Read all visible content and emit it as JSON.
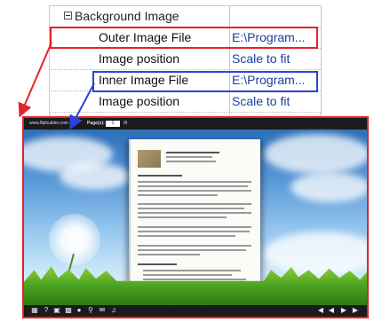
{
  "property_grid": {
    "category": {
      "label": "Background Image"
    },
    "rows": [
      {
        "name": "Outer Image File",
        "value": "E:\\Program..."
      },
      {
        "name": "Image position",
        "value": "Scale to fit"
      },
      {
        "name": "Inner Image File",
        "value": "E:\\Program..."
      },
      {
        "name": "Image position",
        "value": "Scale to fit"
      }
    ]
  },
  "viewer": {
    "toolbar": {
      "site": "www.flipbuilder.com",
      "page_label": "Page(s):",
      "page_value": "1",
      "page_total": "/8"
    },
    "bottom_icons": [
      "thumbnails-icon",
      "help-icon",
      "fullscreen-icon",
      "print-icon",
      "zoom-icon",
      "search-icon",
      "share-icon",
      "sound-icon",
      "first-page-icon",
      "previous-page-icon",
      "next-page-icon",
      "last-page-icon"
    ]
  },
  "colors": {
    "highlight_outer": "#e52228",
    "highlight_inner": "#2742e0",
    "value_text": "#1a3fa0"
  }
}
